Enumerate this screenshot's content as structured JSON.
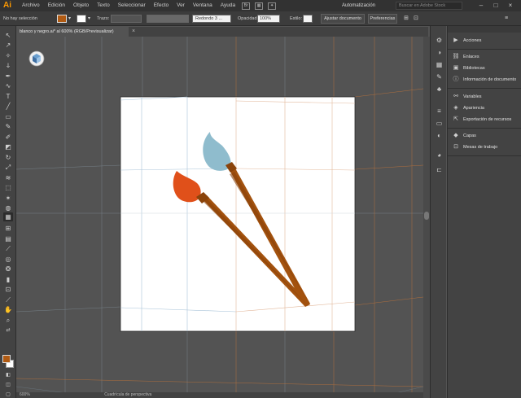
{
  "app": {
    "logo": "Ai",
    "menu": [
      "Archivo",
      "Edición",
      "Objeto",
      "Texto",
      "Seleccionar",
      "Efecto",
      "Ver",
      "Ventana",
      "Ayuda"
    ],
    "workspace": "Automatización",
    "stock_placeholder": "Buscar en Adobe Stock"
  },
  "control_bar": {
    "selection": "No hay selección",
    "stroke_label": "Trazo:",
    "brush": "Redondo 3 ...",
    "opacity_label": "Opacidad:",
    "opacity_value": "100%",
    "style_label": "Estilo:",
    "adjust_document": "Ajustar documento",
    "preferences": "Preferencias",
    "fill_color": "#b05a12"
  },
  "document": {
    "tab_title": "blanco y negro.ai* al 600% (RGB/Previsualizar)",
    "close": "×"
  },
  "status": {
    "zoom": "600%",
    "text": "Cuadrícula de perspectiva"
  },
  "panels": [
    {
      "label": "Acciones",
      "icon": "play-icon"
    },
    {
      "label": "Enlaces",
      "icon": "link-icon"
    },
    {
      "label": "Bibliotecas",
      "icon": "library-icon"
    },
    {
      "label": "Información de documento",
      "icon": "info-icon"
    },
    {
      "label": "Variables",
      "icon": "variables-icon"
    },
    {
      "label": "Apariencia",
      "icon": "appearance-icon"
    },
    {
      "label": "Exportación de recursos",
      "icon": "export-icon"
    },
    {
      "label": "Capas",
      "icon": "layers-icon"
    },
    {
      "label": "Mesas de trabajo",
      "icon": "artboards-icon"
    }
  ],
  "artwork": {
    "brush_blue_color": "#8fbccd",
    "brush_orange_color": "#e0501a",
    "handle_color": "#a3520e"
  }
}
